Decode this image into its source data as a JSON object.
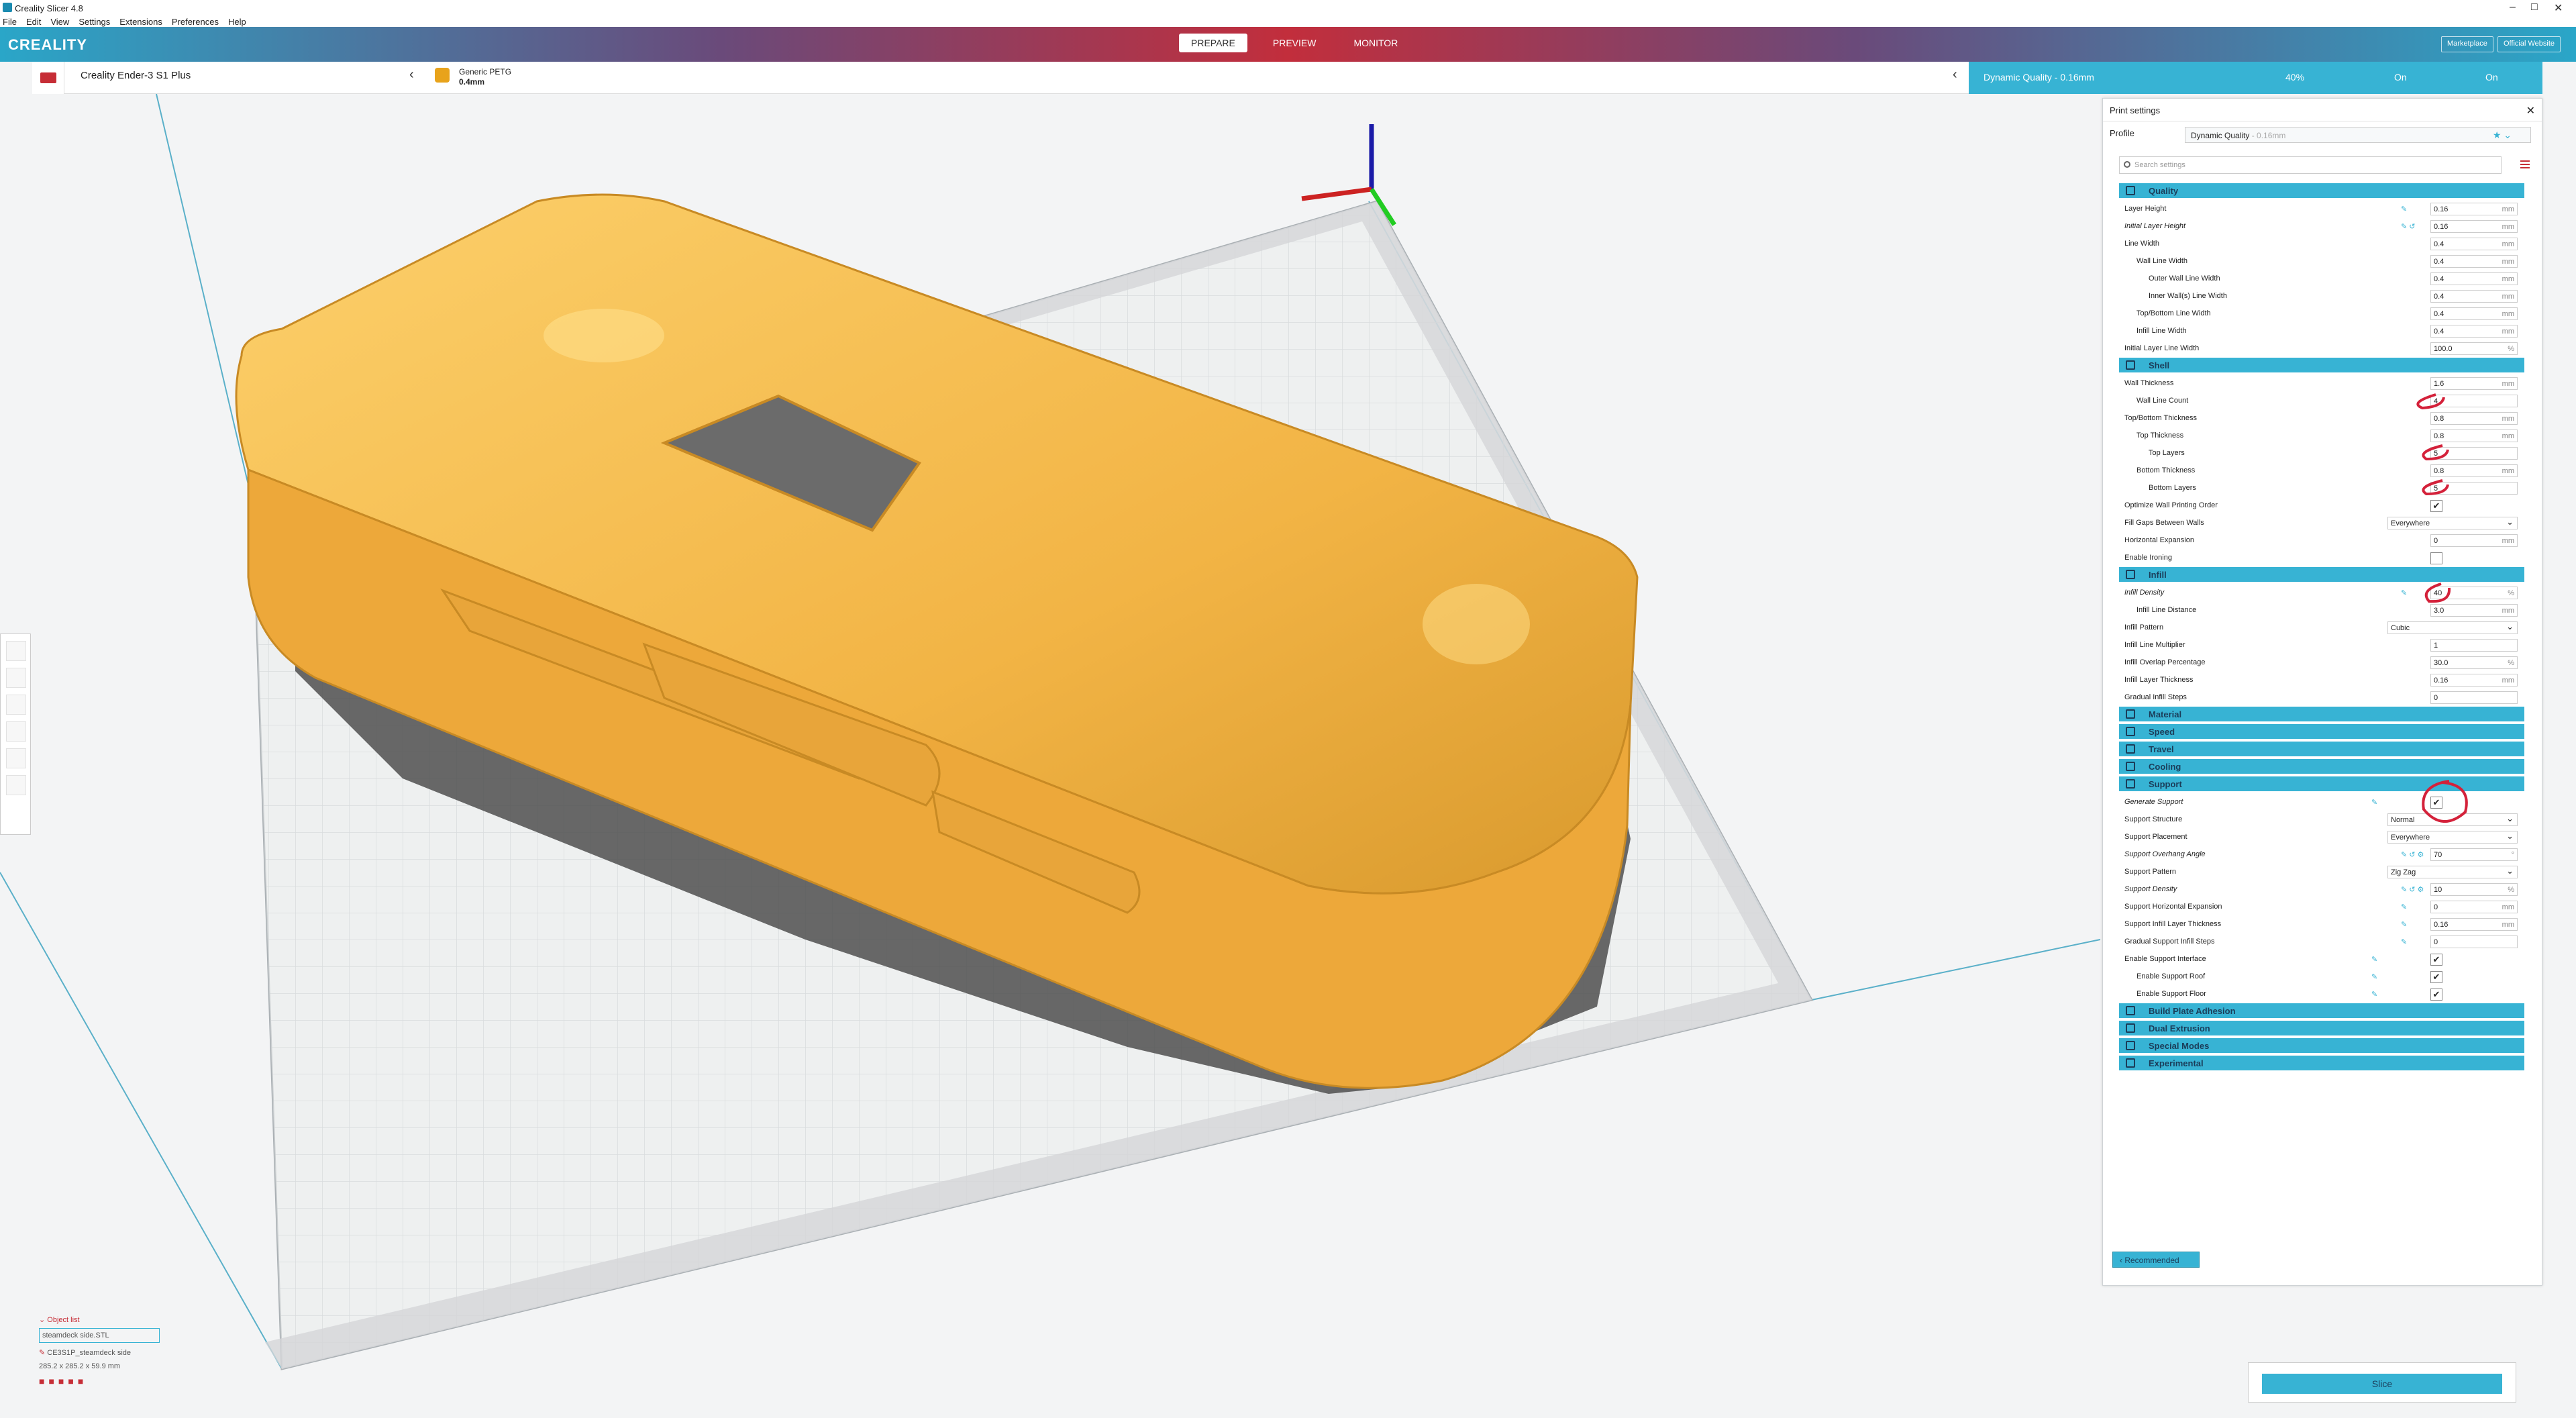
{
  "titlebar": {
    "title": "Creality Slicer 4.8",
    "minimize": "–",
    "maximize": "□",
    "close": "✕"
  },
  "menu": [
    "File",
    "Edit",
    "View",
    "Settings",
    "Extensions",
    "Preferences",
    "Help"
  ],
  "header": {
    "logo": "CREALITY",
    "tabs": [
      "PREPARE",
      "PREVIEW",
      "MONITOR"
    ],
    "active_tab": "PREPARE",
    "marketplace": "Marketplace",
    "official": "Official Website"
  },
  "stagebar": {
    "printer": "Creality Ender-3 S1 Plus",
    "material_name": "Generic PETG",
    "material_size": "0.4mm",
    "quality": "Dynamic Quality - 0.16mm",
    "infill": "40%",
    "support": "On",
    "adhesion": "On"
  },
  "panel": {
    "title": "Print settings",
    "profile_label": "Profile",
    "profile_value": "Dynamic Quality",
    "profile_suffix": "- 0.16mm",
    "search_placeholder": "Search settings",
    "recommended": "Recommended",
    "sections": [
      {
        "cat": "Quality",
        "rows": [
          {
            "l": "Layer Height",
            "v": "0.16",
            "u": "mm",
            "icons": "✎"
          },
          {
            "l": "Initial Layer Height",
            "v": "0.16",
            "u": "mm",
            "em": true,
            "icons": "✎ ↺"
          },
          {
            "l": "Line Width",
            "v": "0.4",
            "u": "mm"
          },
          {
            "l": "Wall Line Width",
            "v": "0.4",
            "u": "mm",
            "ind": 1
          },
          {
            "l": "Outer Wall Line Width",
            "v": "0.4",
            "u": "mm",
            "ind": 2
          },
          {
            "l": "Inner Wall(s) Line Width",
            "v": "0.4",
            "u": "mm",
            "ind": 2
          },
          {
            "l": "Top/Bottom Line Width",
            "v": "0.4",
            "u": "mm",
            "ind": 1
          },
          {
            "l": "Infill Line Width",
            "v": "0.4",
            "u": "mm",
            "ind": 1
          },
          {
            "l": "Initial Layer Line Width",
            "v": "100.0",
            "u": "%"
          }
        ]
      },
      {
        "cat": "Shell",
        "rows": [
          {
            "l": "Wall Thickness",
            "v": "1.6",
            "u": "mm"
          },
          {
            "l": "Wall Line Count",
            "v": "4",
            "u": "",
            "ind": 1
          },
          {
            "l": "Top/Bottom Thickness",
            "v": "0.8",
            "u": "mm"
          },
          {
            "l": "Top Thickness",
            "v": "0.8",
            "u": "mm",
            "ind": 1
          },
          {
            "l": "Top Layers",
            "v": "5",
            "u": "",
            "ind": 2
          },
          {
            "l": "Bottom Thickness",
            "v": "0.8",
            "u": "mm",
            "ind": 1
          },
          {
            "l": "Bottom Layers",
            "v": "5",
            "u": "",
            "ind": 2
          },
          {
            "l": "Optimize Wall Printing Order",
            "cb": "✔"
          },
          {
            "l": "Fill Gaps Between Walls",
            "dd": "Everywhere"
          },
          {
            "l": "Horizontal Expansion",
            "v": "0",
            "u": "mm"
          },
          {
            "l": "Enable Ironing",
            "cb": ""
          }
        ]
      },
      {
        "cat": "Infill",
        "rows": [
          {
            "l": "Infill Density",
            "v": "40",
            "u": "%",
            "em": true,
            "icons": "✎"
          },
          {
            "l": "Infill Line Distance",
            "v": "3.0",
            "u": "mm",
            "ind": 1
          },
          {
            "l": "Infill Pattern",
            "dd": "Cubic"
          },
          {
            "l": "Infill Line Multiplier",
            "v": "1",
            "u": ""
          },
          {
            "l": "Infill Overlap Percentage",
            "v": "30.0",
            "u": "%"
          },
          {
            "l": "Infill Layer Thickness",
            "v": "0.16",
            "u": "mm"
          },
          {
            "l": "Gradual Infill Steps",
            "v": "0",
            "u": ""
          }
        ]
      },
      {
        "cat": "Material",
        "rows": []
      },
      {
        "cat": "Speed",
        "rows": []
      },
      {
        "cat": "Travel",
        "rows": []
      },
      {
        "cat": "Cooling",
        "rows": []
      },
      {
        "cat": "Support",
        "rows": [
          {
            "l": "Generate Support",
            "cb": "✔",
            "em": true,
            "icons": "✎"
          },
          {
            "l": "Support Structure",
            "dd": "Normal"
          },
          {
            "l": "Support Placement",
            "dd": "Everywhere"
          },
          {
            "l": "Support Overhang Angle",
            "v": "70",
            "u": "°",
            "em": true,
            "icons": "✎ ↺ ⚙"
          },
          {
            "l": "Support Pattern",
            "dd": "Zig Zag"
          },
          {
            "l": "Support Density",
            "v": "10",
            "u": "%",
            "em": true,
            "icons": "✎ ↺ ⚙"
          },
          {
            "l": "Support Horizontal Expansion",
            "v": "0",
            "u": "mm",
            "icons": "✎"
          },
          {
            "l": "Support Infill Layer Thickness",
            "v": "0.16",
            "u": "mm",
            "icons": "✎"
          },
          {
            "l": "Gradual Support Infill Steps",
            "v": "0",
            "u": "",
            "icons": "✎"
          },
          {
            "l": "Enable Support Interface",
            "cb": "✔",
            "icons": "✎"
          },
          {
            "l": "Enable Support Roof",
            "cb": "✔",
            "ind": 1,
            "icons": "✎"
          },
          {
            "l": "Enable Support Floor",
            "cb": "✔",
            "ind": 1,
            "icons": "✎"
          }
        ]
      },
      {
        "cat": "Build Plate Adhesion",
        "rows": []
      },
      {
        "cat": "Dual Extrusion",
        "rows": []
      },
      {
        "cat": "Special Modes",
        "rows": []
      },
      {
        "cat": "Experimental",
        "rows": []
      }
    ]
  },
  "objects": {
    "title": "Object list",
    "file": "steamdeck side.STL",
    "job": "CE3S1P_steamdeck side",
    "dims": "285.2 x 285.2 x 59.9 mm"
  },
  "slice": "Slice",
  "colors": {
    "accent": "#37b3d4",
    "model": "#f5b846",
    "annotation": "#d4213a"
  }
}
